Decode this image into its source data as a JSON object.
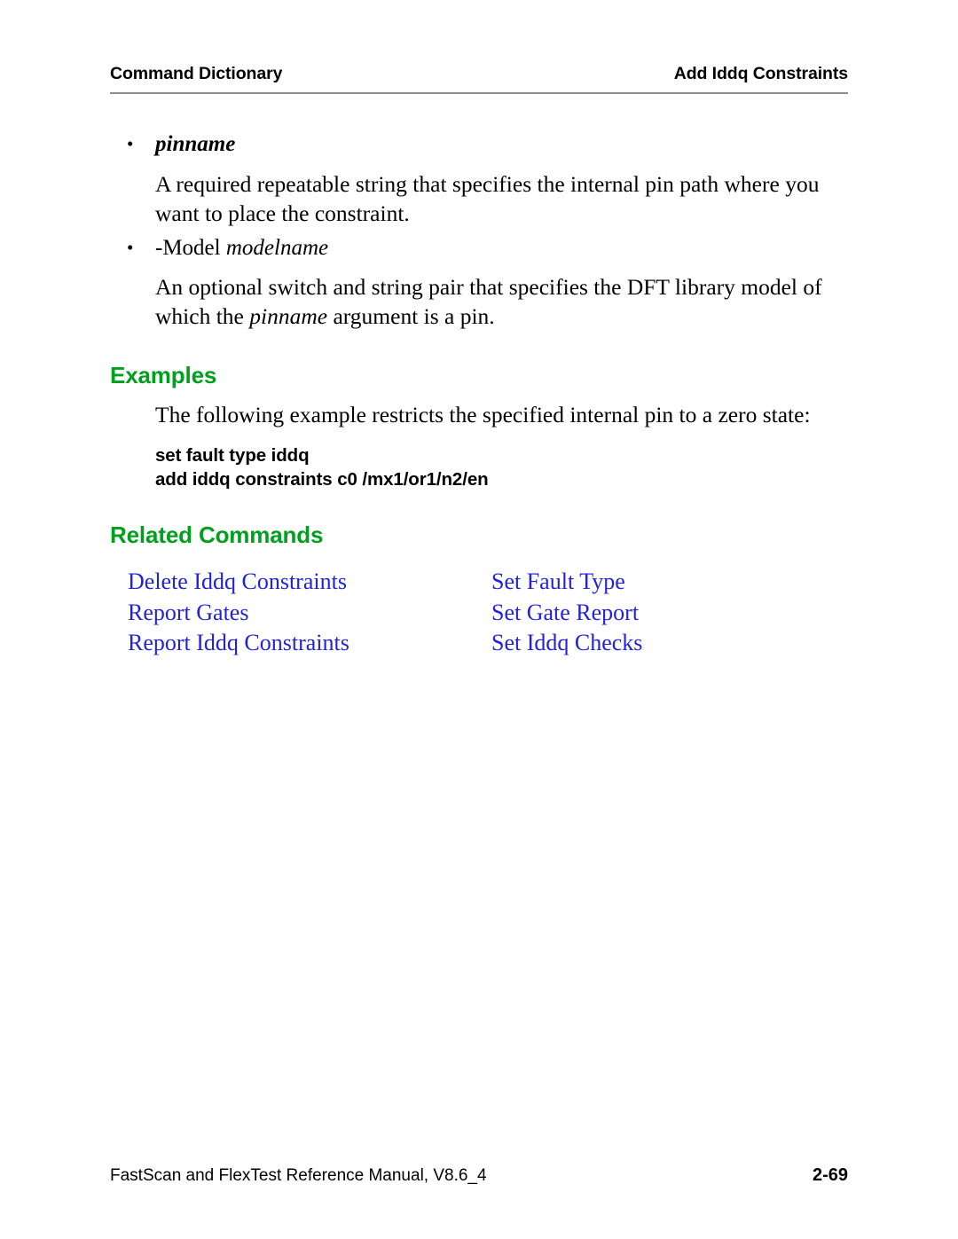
{
  "header": {
    "left": "Command Dictionary",
    "right": "Add Iddq Constraints"
  },
  "body": {
    "bullets": [
      {
        "marker": "•",
        "term_italic_bold": "pinname",
        "term_plain": "",
        "term_italic": "",
        "description_parts": {
          "a": "A required repeatable string that specifies the internal pin path where you want to place the constraint.",
          "b": "",
          "c": ""
        }
      },
      {
        "marker": "•",
        "term_italic_bold": "",
        "term_plain": "-Model ",
        "term_italic": "modelname",
        "description_parts": {
          "a": "An optional switch and string pair that specifies the DFT library model of which the ",
          "b": "pinname",
          "c": " argument is a pin."
        }
      }
    ]
  },
  "examples": {
    "heading": "Examples",
    "intro": "The following example restricts the specified internal pin to a zero state:",
    "code_lines": [
      "set fault type iddq",
      "add iddq constraints c0 /mx1/or1/n2/en"
    ]
  },
  "related_commands": {
    "heading": "Related Commands",
    "links": [
      "Delete Iddq Constraints",
      "Set Fault Type",
      "Report Gates",
      "Set Gate Report",
      "Report Iddq Constraints",
      "Set Iddq Checks"
    ]
  },
  "footer": {
    "manual": "FastScan and FlexTest Reference Manual, V8.6_4",
    "page_number": "2-69"
  },
  "colors": {
    "heading_green": "#00a01e",
    "link_blue": "#2222dd",
    "rule_gray": "#8c8c8c"
  }
}
